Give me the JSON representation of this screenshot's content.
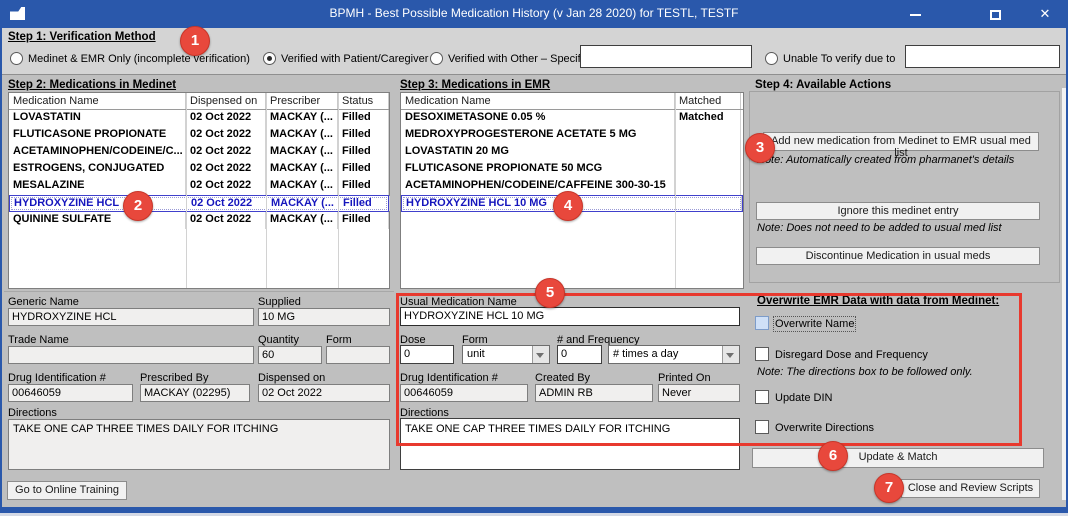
{
  "window": {
    "title": "BPMH - Best Possible Medication History (v Jan 28 2020) for TESTL, TESTF",
    "controls": {
      "minimize": "minimize-icon",
      "maximize": "maximize-icon",
      "close_glyph": "✕"
    }
  },
  "badges": {
    "b1": "1",
    "b2": "2",
    "b3": "3",
    "b4": "4",
    "b5": "5",
    "b6": "6",
    "b7": "7"
  },
  "step1": {
    "heading": "Step 1: Verification Method",
    "options": [
      {
        "label": "Medinet & EMR Only (incomplete verification)",
        "selected": false
      },
      {
        "label": "Verified with Patient/Caregiver",
        "selected": true
      },
      {
        "label": "Verified with Other – Specify",
        "selected": false,
        "input_value": ""
      },
      {
        "label": "Unable To verify due to",
        "selected": false,
        "input_value": ""
      }
    ]
  },
  "step2": {
    "heading": "Step 2: Medications in Medinet",
    "columns": [
      "Medication Name",
      "Dispensed on",
      "Prescriber",
      "Status"
    ],
    "rows": [
      {
        "name": "LOVASTATIN",
        "dispensed": "02 Oct 2022",
        "prescriber": "MACKAY (...",
        "status": "Filled"
      },
      {
        "name": "FLUTICASONE PROPIONATE",
        "dispensed": "02 Oct 2022",
        "prescriber": "MACKAY (...",
        "status": "Filled"
      },
      {
        "name": "ACETAMINOPHEN/CODEINE/C...",
        "dispensed": "02 Oct 2022",
        "prescriber": "MACKAY (...",
        "status": "Filled"
      },
      {
        "name": "ESTROGENS, CONJUGATED",
        "dispensed": "02 Oct 2022",
        "prescriber": "MACKAY (...",
        "status": "Filled"
      },
      {
        "name": "MESALAZINE",
        "dispensed": "02 Oct 2022",
        "prescriber": "MACKAY (...",
        "status": "Filled"
      },
      {
        "name": "HYDROXYZINE HCL",
        "dispensed": "02 Oct 2022",
        "prescriber": "MACKAY (...",
        "status": "Filled"
      },
      {
        "name": "QUININE SULFATE",
        "dispensed": "02 Oct 2022",
        "prescriber": "MACKAY (...",
        "status": "Filled"
      }
    ],
    "selected_row_index": 5
  },
  "step3": {
    "heading": "Step 3: Medications in EMR",
    "columns": [
      "Medication Name",
      "Matched"
    ],
    "rows": [
      {
        "name": "DESOXIMETASONE 0.05 %",
        "matched": "Matched"
      },
      {
        "name": "MEDROXYPROGESTERONE ACETATE 5 MG",
        "matched": ""
      },
      {
        "name": "LOVASTATIN 20 MG",
        "matched": ""
      },
      {
        "name": "FLUTICASONE PROPIONATE 50 MCG",
        "matched": ""
      },
      {
        "name": "ACETAMINOPHEN/CODEINE/CAFFEINE 300-30-15",
        "matched": ""
      },
      {
        "name": "HYDROXYZINE HCL 10 MG",
        "matched": ""
      }
    ],
    "selected_row_index": 5
  },
  "step4": {
    "heading": "Step 4: Available Actions",
    "add_button": "Add new medication from Medinet to EMR usual med list",
    "add_note": "Note: Automatically created from pharmanet's details",
    "ignore_button": "Ignore this medinet entry",
    "ignore_note": "Note: Does not need to be added to usual med list",
    "discontinue_button": "Discontinue Medication in usual meds"
  },
  "medinet_details": {
    "generic_name_label": "Generic Name",
    "generic_name": "HYDROXYZINE HCL",
    "supplied_label": "Supplied",
    "supplied": "10 MG",
    "trade_name_label": "Trade Name",
    "trade_name": "",
    "quantity_label": "Quantity",
    "quantity": "60",
    "form_label": "Form",
    "form": "",
    "din_label": "Drug Identification #",
    "din": "00646059",
    "prescribed_by_label": "Prescribed By",
    "prescribed_by": "MACKAY (02295)",
    "dispensed_on_label": "Dispensed on",
    "dispensed_on": "02 Oct 2022",
    "directions_label": "Directions",
    "directions": "TAKE ONE CAP THREE TIMES DAILY FOR ITCHING"
  },
  "emr_details": {
    "usual_name_label": "Usual Medication Name",
    "usual_name": "HYDROXYZINE HCL 10 MG",
    "dose_label": "Dose",
    "dose": "0",
    "form_label": "Form",
    "form": "unit",
    "frequency_label": "# and Frequency",
    "frequency_count": "0",
    "frequency_unit": "# times a day",
    "din_label": "Drug Identification #",
    "din": "00646059",
    "created_by_label": "Created By",
    "created_by": "ADMIN RB",
    "printed_on_label": "Printed On",
    "printed_on": "Never",
    "directions_label": "Directions",
    "directions": "TAKE ONE CAP THREE TIMES DAILY FOR ITCHING"
  },
  "overwrite_panel": {
    "heading": "Overwrite EMR Data with data from Medinet:",
    "cb_overwrite_name": "Overwrite Name",
    "cb_disregard": "Disregard Dose and Frequency",
    "disregard_note": "Note: The directions box to be followed only.",
    "cb_update_din": "Update DIN",
    "cb_overwrite_directions": "Overwrite Directions",
    "update_button": "Update & Match"
  },
  "footer": {
    "training_button": "Go to Online Training",
    "close_button": "Close and Review Scripts"
  },
  "colors": {
    "titlebar": "#2a58ab",
    "badge": "#e8483c",
    "selection": "#1515bd",
    "annotation": "#e8392e"
  }
}
